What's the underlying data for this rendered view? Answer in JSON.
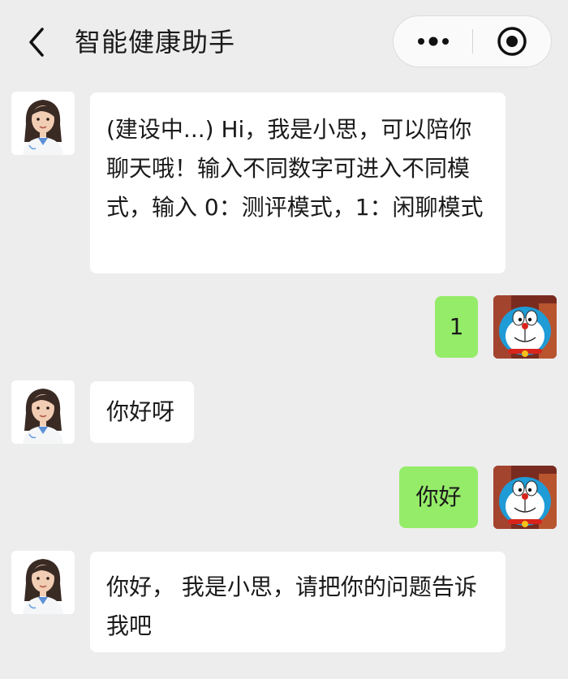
{
  "header": {
    "title": "智能健康助手",
    "back_icon": "chevron-left-icon",
    "more_icon": "more-dots-icon",
    "close_icon": "target-close-icon"
  },
  "colors": {
    "background": "#ededed",
    "bot_bubble": "#ffffff",
    "user_bubble": "#95ec69"
  },
  "messages": [
    {
      "sender": "bot",
      "avatar": "doctor-avatar",
      "text": "(建设中...) Hi，我是小思，可以陪你聊天哦！输入不同数字可进入不同模式，输入 0：测评模式，1：闲聊模式"
    },
    {
      "sender": "user",
      "avatar": "doraemon-avatar",
      "text": "1"
    },
    {
      "sender": "bot",
      "avatar": "doctor-avatar",
      "text": "你好呀"
    },
    {
      "sender": "user",
      "avatar": "doraemon-avatar",
      "text": "你好"
    },
    {
      "sender": "bot",
      "avatar": "doctor-avatar",
      "text": "你好， 我是小思，请把你的问题告诉我吧"
    }
  ]
}
